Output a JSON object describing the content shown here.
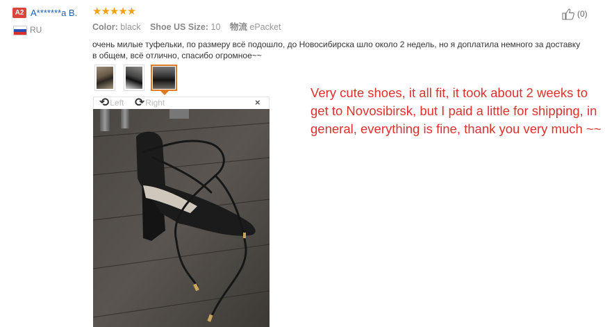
{
  "reviewer": {
    "level_badge": "A2",
    "name": "A*******a B.",
    "country": "RU",
    "flag_icon": "russia-flag-icon"
  },
  "rating": {
    "stars": 5,
    "display": "★★★★★"
  },
  "attributes": {
    "color_key": "Color:",
    "color_value": "black",
    "size_key": "Shoe US Size:",
    "size_value": "10",
    "shipping_key": "物流",
    "shipping_value": "ePacket"
  },
  "helpful": {
    "icon": "thumbs-up-icon",
    "count": "(0)"
  },
  "review": {
    "line1": "очень милые туфельки, по размеру всё подошло, до Новосибирска шло около 2 недель, но я доплатила немного за доставку",
    "line2": "в общем, всё отлично, спасибо огромное~~"
  },
  "viewer": {
    "rotate_left_icon": "rotate-left-icon",
    "rotate_left_label": "Left",
    "rotate_right_icon": "rotate-right-icon",
    "rotate_right_label": "Right",
    "close_label": "×",
    "thumbnails": 3,
    "selected_thumbnail": 3
  },
  "translation": "Very cute shoes, it all fit, it took about 2 weeks to get to Novosibirsk, but I paid a little for shipping, in general, everything is fine, thank you very much ~~",
  "colors": {
    "badge": "#d9463b",
    "username": "#1a5fb4",
    "stars": "#f2a016",
    "selected_thumb_border": "#e07b24",
    "translation_text": "#e0302e"
  }
}
